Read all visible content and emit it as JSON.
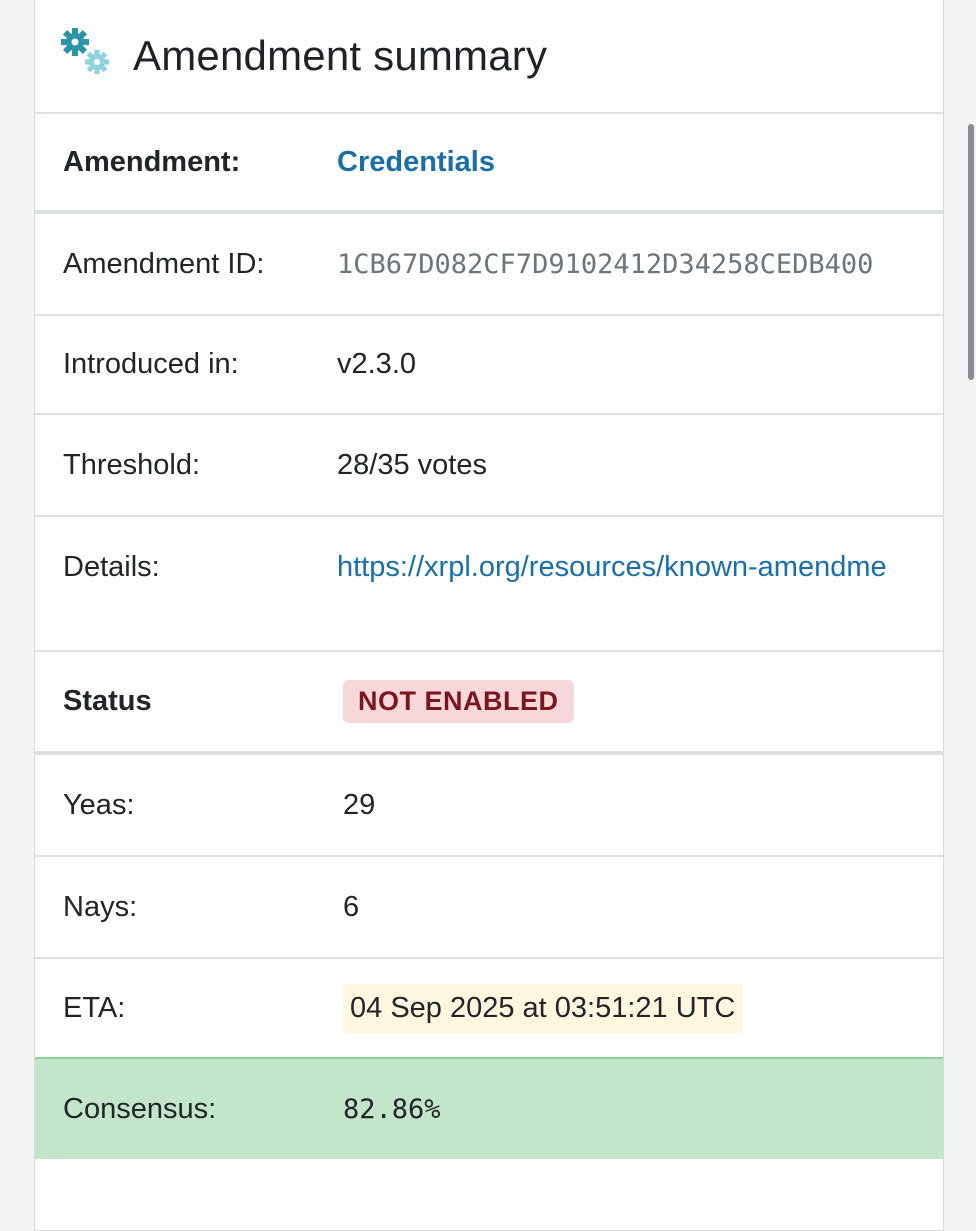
{
  "header": {
    "title": "Amendment summary",
    "icon": "gears-icon"
  },
  "rows": {
    "amendment": {
      "label": "Amendment:",
      "value": "Credentials"
    },
    "amendment_id": {
      "label": "Amendment ID:",
      "value": "1CB67D082CF7D9102412D34258CEDB400"
    },
    "introduced": {
      "label": "Introduced in:",
      "value": "v2.3.0"
    },
    "threshold": {
      "label": "Threshold:",
      "value": "28/35 votes"
    },
    "details": {
      "label": "Details:",
      "value": "https://xrpl.org/resources/known-amendme"
    },
    "status": {
      "label": "Status",
      "value": "NOT ENABLED"
    },
    "yeas": {
      "label": "Yeas:",
      "value": "29"
    },
    "nays": {
      "label": "Nays:",
      "value": "6"
    },
    "eta": {
      "label": "ETA:",
      "value": "04 Sep 2025 at 03:51:21 UTC"
    },
    "consensus": {
      "label": "Consensus:",
      "value": "82.86%"
    }
  },
  "colors": {
    "link": "#1a6fa8",
    "status_badge_bg": "#f7d7da",
    "status_badge_text": "#7a1620",
    "eta_bg": "#fdf7df",
    "consensus_bg": "#c3e5ca",
    "gear_primary": "#2a95a8",
    "gear_secondary": "#8fd3e0"
  }
}
